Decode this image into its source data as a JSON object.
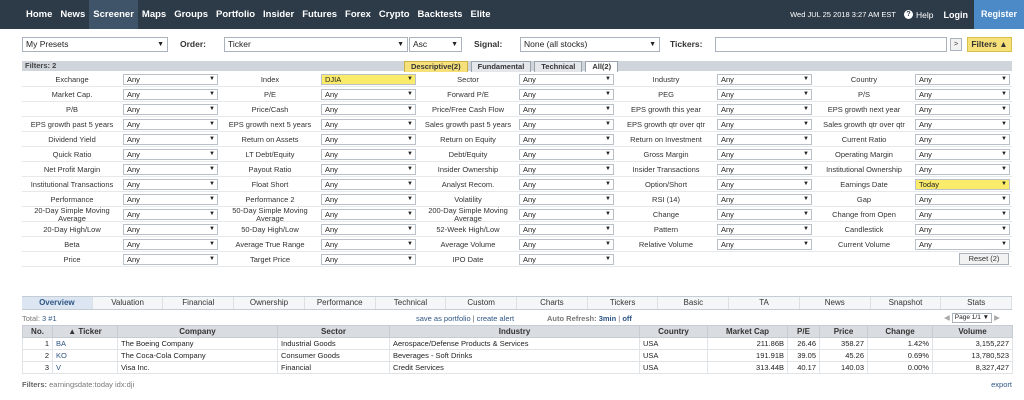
{
  "nav": {
    "items": [
      "Home",
      "News",
      "Screener",
      "Maps",
      "Groups",
      "Portfolio",
      "Insider",
      "Futures",
      "Forex",
      "Crypto",
      "Backtests",
      "Elite"
    ],
    "active": "Screener",
    "date": "Wed JUL 25 2018 3:27 AM EST",
    "help": "Help",
    "login": "Login",
    "register": "Register"
  },
  "toolbar": {
    "presets": "My Presets",
    "order_label": "Order:",
    "order_value": "Ticker",
    "direction": "Asc",
    "signal_label": "Signal:",
    "signal_value": "None (all stocks)",
    "tickers_label": "Tickers:",
    "tickers_value": "",
    "go": ">",
    "filters_button": "Filters ▲"
  },
  "filters": {
    "count_label": "Filters: 2",
    "tabs": [
      "Descriptive(2)",
      "Fundamental",
      "Technical",
      "All(2)"
    ],
    "reset": "Reset (2)",
    "rows": [
      [
        [
          "Exchange",
          "Any"
        ],
        [
          "Index",
          "DJIA"
        ],
        [
          "Sector",
          "Any"
        ],
        [
          "Industry",
          "Any"
        ],
        [
          "Country",
          "Any"
        ]
      ],
      [
        [
          "Market Cap.",
          "Any"
        ],
        [
          "P/E",
          "Any"
        ],
        [
          "Forward P/E",
          "Any"
        ],
        [
          "PEG",
          "Any"
        ],
        [
          "P/S",
          "Any"
        ]
      ],
      [
        [
          "P/B",
          "Any"
        ],
        [
          "Price/Cash",
          "Any"
        ],
        [
          "Price/Free Cash Flow",
          "Any"
        ],
        [
          "EPS growth this year",
          "Any"
        ],
        [
          "EPS growth next year",
          "Any"
        ]
      ],
      [
        [
          "EPS growth past 5 years",
          "Any"
        ],
        [
          "EPS growth next 5 years",
          "Any"
        ],
        [
          "Sales growth past 5 years",
          "Any"
        ],
        [
          "EPS growth qtr over qtr",
          "Any"
        ],
        [
          "Sales growth qtr over qtr",
          "Any"
        ]
      ],
      [
        [
          "Dividend Yield",
          "Any"
        ],
        [
          "Return on Assets",
          "Any"
        ],
        [
          "Return on Equity",
          "Any"
        ],
        [
          "Return on Investment",
          "Any"
        ],
        [
          "Current Ratio",
          "Any"
        ]
      ],
      [
        [
          "Quick Ratio",
          "Any"
        ],
        [
          "LT Debt/Equity",
          "Any"
        ],
        [
          "Debt/Equity",
          "Any"
        ],
        [
          "Gross Margin",
          "Any"
        ],
        [
          "Operating Margin",
          "Any"
        ]
      ],
      [
        [
          "Net Profit Margin",
          "Any"
        ],
        [
          "Payout Ratio",
          "Any"
        ],
        [
          "Insider Ownership",
          "Any"
        ],
        [
          "Insider Transactions",
          "Any"
        ],
        [
          "Institutional Ownership",
          "Any"
        ]
      ],
      [
        [
          "Institutional Transactions",
          "Any"
        ],
        [
          "Float Short",
          "Any"
        ],
        [
          "Analyst Recom.",
          "Any"
        ],
        [
          "Option/Short",
          "Any"
        ],
        [
          "Earnings Date",
          "Today"
        ]
      ],
      [
        [
          "Performance",
          "Any"
        ],
        [
          "Performance 2",
          "Any"
        ],
        [
          "Volatility",
          "Any"
        ],
        [
          "RSI (14)",
          "Any"
        ],
        [
          "Gap",
          "Any"
        ]
      ],
      [
        [
          "20-Day Simple Moving Average",
          "Any"
        ],
        [
          "50-Day Simple Moving Average",
          "Any"
        ],
        [
          "200-Day Simple Moving Average",
          "Any"
        ],
        [
          "Change",
          "Any"
        ],
        [
          "Change from Open",
          "Any"
        ]
      ],
      [
        [
          "20-Day High/Low",
          "Any"
        ],
        [
          "50-Day High/Low",
          "Any"
        ],
        [
          "52-Week High/Low",
          "Any"
        ],
        [
          "Pattern",
          "Any"
        ],
        [
          "Candlestick",
          "Any"
        ]
      ],
      [
        [
          "Beta",
          "Any"
        ],
        [
          "Average True Range",
          "Any"
        ],
        [
          "Average Volume",
          "Any"
        ],
        [
          "Relative Volume",
          "Any"
        ],
        [
          "Current Volume",
          "Any"
        ]
      ],
      [
        [
          "Price",
          "Any"
        ],
        [
          "Target Price",
          "Any"
        ],
        [
          "IPO Date",
          "Any"
        ]
      ]
    ]
  },
  "view_tabs": [
    "Overview",
    "Valuation",
    "Financial",
    "Ownership",
    "Performance",
    "Technical",
    "Custom",
    "Charts",
    "Tickers",
    "Basic",
    "TA",
    "News",
    "Snapshot",
    "Stats"
  ],
  "results": {
    "total_label": "Total:",
    "total_value": "3 #1",
    "save_portfolio": "save as portfolio",
    "create_alert": "create alert",
    "auto_refresh_label": "Auto Refresh:",
    "auto_refresh_value": "3min",
    "auto_refresh_off": "off",
    "page": "Page 1/1",
    "columns": [
      "No.",
      "▲ Ticker",
      "Company",
      "Sector",
      "Industry",
      "Country",
      "Market Cap",
      "P/E",
      "Price",
      "Change",
      "Volume"
    ],
    "rows": [
      [
        "1",
        "BA",
        "The Boeing Company",
        "Industrial Goods",
        "Aerospace/Defense Products & Services",
        "USA",
        "211.86B",
        "26.46",
        "358.27",
        "1.42%",
        "3,155,227"
      ],
      [
        "2",
        "KO",
        "The Coca-Cola Company",
        "Consumer Goods",
        "Beverages - Soft Drinks",
        "USA",
        "191.91B",
        "39.05",
        "45.26",
        "0.69%",
        "13,780,523"
      ],
      [
        "3",
        "V",
        "Visa Inc.",
        "Financial",
        "Credit Services",
        "USA",
        "313.44B",
        "40.17",
        "140.03",
        "0.00%",
        "8,327,427"
      ]
    ],
    "footer_label": "Filters:",
    "footer_value": "earningsdate:today idx:dji",
    "export": "export"
  },
  "colors": {
    "nav_bg": "#2d3a48",
    "accent": "#4b89c7",
    "highlight": "#fbeb6b",
    "positive": "#2a9b3e"
  }
}
